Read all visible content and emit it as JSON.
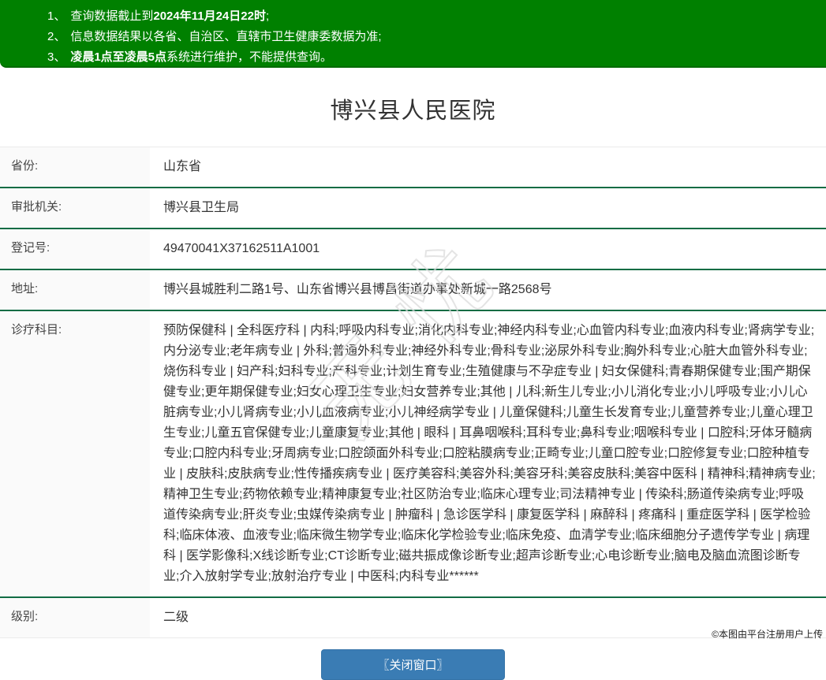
{
  "notice": {
    "items": [
      {
        "num": "1、",
        "pre": "查询数据截止到",
        "bold": "2024年11月24日22时",
        "post": ";"
      },
      {
        "num": "2、",
        "pre": "信息数据结果以各省、自治区、直辖市卫生健康委数据为准;",
        "bold": "",
        "post": ""
      },
      {
        "num": "3、",
        "pre": "",
        "bold": "凌晨1点至凌晨5点",
        "post": "系统进行维护，不能提供查询。"
      }
    ]
  },
  "title": "博兴县人民医院",
  "fields": [
    {
      "label": "省份:",
      "value": "山东省"
    },
    {
      "label": "审批机关:",
      "value": "博兴县卫生局"
    },
    {
      "label": "登记号:",
      "value": "49470041X37162511A1001"
    },
    {
      "label": "地址:",
      "value": "博兴县城胜利二路1号、山东省博兴县博昌街道办事处新城一路2568号"
    },
    {
      "label": "诊疗科目:",
      "value": "预防保健科 | 全科医疗科 | 内科;呼吸内科专业;消化内科专业;神经内科专业;心血管内科专业;血液内科专业;肾病学专业;内分泌专业;老年病专业 | 外科;普通外科专业;神经外科专业;骨科专业;泌尿外科专业;胸外科专业;心脏大血管外科专业;烧伤科专业 | 妇产科;妇科专业;产科专业;计划生育专业;生殖健康与不孕症专业 | 妇女保健科;青春期保健专业;围产期保健专业;更年期保健专业;妇女心理卫生专业;妇女营养专业;其他 | 儿科;新生儿专业;小儿消化专业;小儿呼吸专业;小儿心脏病专业;小儿肾病专业;小儿血液病专业;小儿神经病学专业 | 儿童保健科;儿童生长发育专业;儿童营养专业;儿童心理卫生专业;儿童五官保健专业;儿童康复专业;其他 | 眼科 | 耳鼻咽喉科;耳科专业;鼻科专业;咽喉科专业 | 口腔科;牙体牙髓病专业;口腔内科专业;牙周病专业;口腔颌面外科专业;口腔粘膜病专业;正畸专业;儿童口腔专业;口腔修复专业;口腔种植专业 | 皮肤科;皮肤病专业;性传播疾病专业 | 医疗美容科;美容外科;美容牙科;美容皮肤科;美容中医科 | 精神科;精神病专业;精神卫生专业;药物依赖专业;精神康复专业;社区防治专业;临床心理专业;司法精神专业 | 传染科;肠道传染病专业;呼吸道传染病专业;肝炎专业;虫媒传染病专业 | 肿瘤科 | 急诊医学科 | 康复医学科 | 麻醉科 | 疼痛科 | 重症医学科 | 医学检验科;临床体液、血液专业;临床微生物学专业;临床化学检验专业;临床免疫、血清学专业;临床细胞分子遗传学专业 | 病理科 | 医学影像科;X线诊断专业;CT诊断专业;磁共振成像诊断专业;超声诊断专业;心电诊断专业;脑电及脑血流图诊断专业;介入放射学专业;放射治疗专业 | 中医科;内科专业******"
    },
    {
      "label": "级别:",
      "value": "二级"
    }
  ],
  "close_button": {
    "label": "〖关闭窗口〗"
  },
  "watermark": {
    "text": "无忧"
  },
  "footer": {
    "caption": "©本图由平台注册用户上传"
  },
  "colors": {
    "banner_green": "#008000",
    "separator_green": "#116c44",
    "label_bg": "#fafafa",
    "button_blue": "#3a7cb4"
  }
}
